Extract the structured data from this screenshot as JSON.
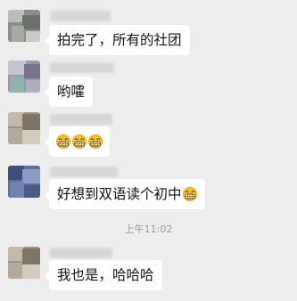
{
  "messages": [
    {
      "text": "拍完了，所有的社团",
      "sender": ""
    },
    {
      "text": "哟嚯",
      "sender": ""
    },
    {
      "text": "",
      "sender": "",
      "emojis": [
        "grinning-face",
        "grinning-face",
        "grinning-face"
      ]
    },
    {
      "text": "好想到双语读个初中",
      "sender": "",
      "trailing_emoji": "grinning-face"
    },
    {
      "text": "我也是，哈哈哈",
      "sender": ""
    }
  ],
  "timestamp": "上午11:02",
  "colors": {
    "background": "#ededed",
    "bubble": "#ffffff",
    "timestamp": "#9a9a9a",
    "emoji": "#f5c02d"
  }
}
